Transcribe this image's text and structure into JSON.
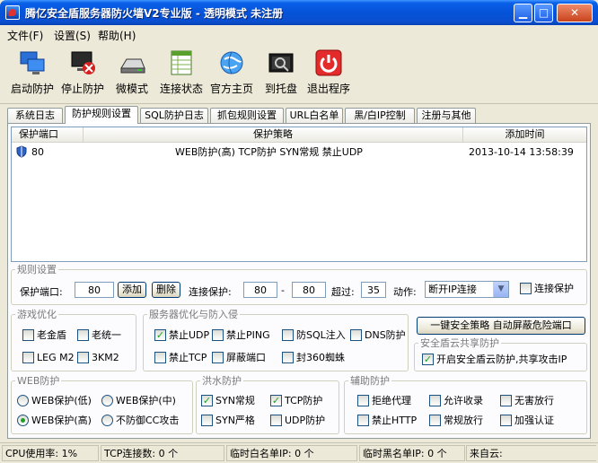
{
  "window": {
    "title": "腾亿安全盾服务器防火墙V2专业版 - 透明模式 未注册",
    "min_glyph": "▁",
    "max_glyph": "□",
    "close_glyph": "✕"
  },
  "menu": [
    "文件(F)",
    "设置(S)",
    "帮助(H)"
  ],
  "toolbar": [
    {
      "label": "启动防护",
      "icon": "monitors-start-icon"
    },
    {
      "label": "停止防护",
      "icon": "monitor-stop-icon"
    },
    {
      "label": "微模式",
      "icon": "drive-mini-icon"
    },
    {
      "label": "连接状态",
      "icon": "table-status-icon"
    },
    {
      "label": "官方主页",
      "icon": "globe-home-icon"
    },
    {
      "label": "到托盘",
      "icon": "tray-icon"
    },
    {
      "label": "退出程序",
      "icon": "power-exit-icon"
    }
  ],
  "tabs": [
    "系统日志",
    "防护规则设置",
    "SQL防护日志",
    "抓包规则设置",
    "URL白名单",
    "黑/白IP控制",
    "注册与其他"
  ],
  "active_tab": 1,
  "list": {
    "headers": [
      "保护端口",
      "保护策略",
      "添加时间"
    ],
    "rows": [
      {
        "port": "80",
        "policy": "WEB防护(高) TCP防护 SYN常规 禁止UDP",
        "time": "2013-10-14 13:58:39"
      }
    ]
  },
  "rules": {
    "legend": "规则设置",
    "port_label": "保护端口:",
    "port_value": "80",
    "add_button": "添加",
    "delete_button": "删除",
    "conn_label": "连接保护:",
    "conn_from": "80",
    "dash": "-",
    "conn_to": "80",
    "exceed_label": "超过:",
    "exceed_value": "35",
    "action_label": "动作:",
    "action_value": "断开IP连接",
    "conn_protect_label": "连接保护",
    "conn_protect_checked": false
  },
  "game": {
    "legend": "游戏优化",
    "items": [
      {
        "label": "老金盾",
        "checked": false
      },
      {
        "label": "老统一",
        "checked": false
      },
      {
        "label": "LEG M2",
        "checked": false
      },
      {
        "label": "3KM2",
        "checked": false
      }
    ]
  },
  "server": {
    "legend": "服务器优化与防入侵",
    "items": [
      {
        "label": "禁止UDP",
        "checked": true
      },
      {
        "label": "禁止PING",
        "checked": false
      },
      {
        "label": "防SQL注入",
        "checked": false
      },
      {
        "label": "DNS防护",
        "checked": false
      },
      {
        "label": "禁止TCP",
        "checked": false
      },
      {
        "label": "屏蔽端口",
        "checked": false
      },
      {
        "label": "封360蜘蛛",
        "checked": false
      }
    ]
  },
  "oneclick": {
    "label": "一键安全策略 自动屏蔽危险端口"
  },
  "cloud": {
    "legend": "安全盾云共享防护",
    "label": "开启安全盾云防护,共享攻击IP",
    "checked": true
  },
  "web": {
    "legend": "WEB防护",
    "items": [
      {
        "label": "WEB保护(低)",
        "checked": false
      },
      {
        "label": "WEB保护(中)",
        "checked": false
      },
      {
        "label": "WEB保护(高)",
        "checked": true
      },
      {
        "label": "不防御CC攻击",
        "checked": false
      }
    ]
  },
  "flood": {
    "legend": "洪水防护",
    "items": [
      {
        "label": "SYN常规",
        "checked": true
      },
      {
        "label": "TCP防护",
        "checked": true
      },
      {
        "label": "SYN严格",
        "checked": false
      },
      {
        "label": "UDP防护",
        "checked": false
      }
    ]
  },
  "aux": {
    "legend": "辅助防护",
    "items": [
      {
        "label": "拒绝代理",
        "checked": false
      },
      {
        "label": "允许收录",
        "checked": false
      },
      {
        "label": "无害放行",
        "checked": false
      },
      {
        "label": "禁止HTTP",
        "checked": false
      },
      {
        "label": "常规放行",
        "checked": false
      },
      {
        "label": "加强认证",
        "checked": false
      }
    ]
  },
  "status": [
    "CPU使用率: 1%",
    "TCP连接数: 0 个",
    "临时白名单IP: 0 个",
    "临时黑名单IP: 0 个",
    "来自云:"
  ],
  "colors": {
    "titlebar": "#0553d8",
    "check": "#21a121",
    "accent": "#316ac5"
  }
}
